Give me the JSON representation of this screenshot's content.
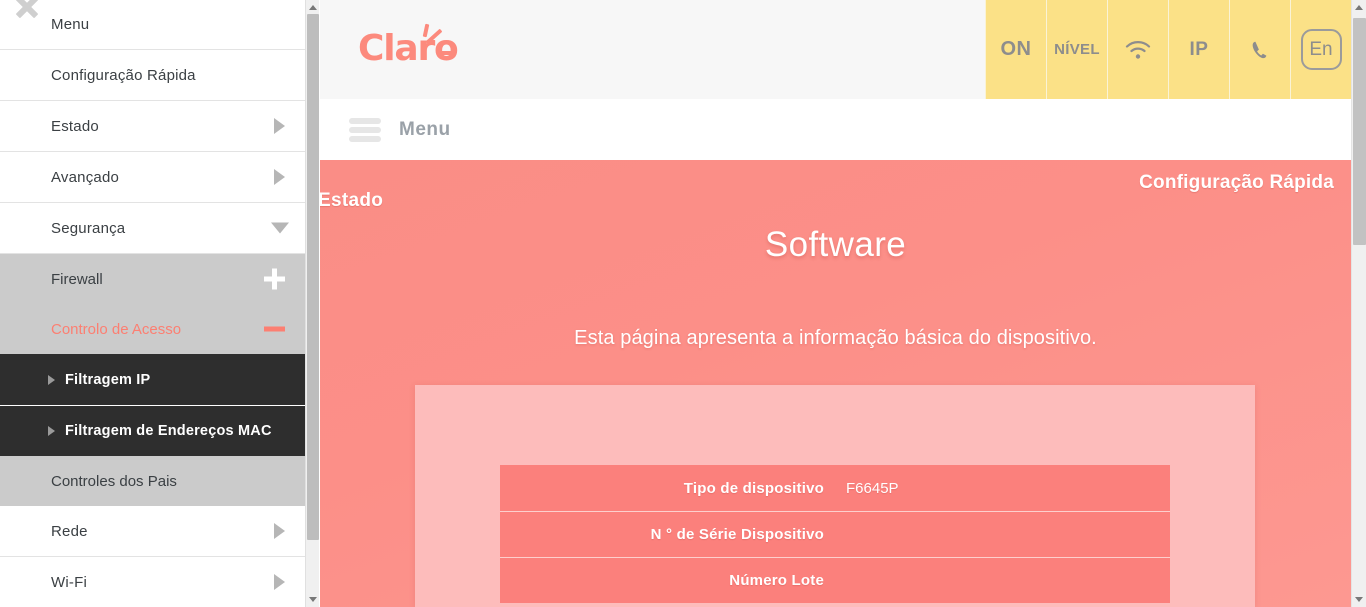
{
  "sidebar": {
    "close_icon": "close-x-icon",
    "top_label": "Menu",
    "items": [
      {
        "label": "Configuração Rápida",
        "arrow": "none"
      },
      {
        "label": "Estado",
        "arrow": "right"
      },
      {
        "label": "Avançado",
        "arrow": "right"
      },
      {
        "label": "Segurança",
        "arrow": "down"
      }
    ],
    "group": {
      "rows": [
        {
          "label": "Firewall",
          "toggle": "plus"
        },
        {
          "label": "Controlo de Acesso",
          "toggle": "minus",
          "active": true
        }
      ],
      "sub_items": [
        {
          "label": "Filtragem IP"
        },
        {
          "label": "Filtragem de Endereços MAC"
        }
      ],
      "tail_row": {
        "label": "Controles dos Pais"
      }
    },
    "items_after": [
      {
        "label": "Rede",
        "arrow": "right"
      },
      {
        "label": "Wi-Fi",
        "arrow": "right"
      }
    ]
  },
  "header": {
    "logo_text": "Claro",
    "status": {
      "on": "ON",
      "nivel": "NÍVEL",
      "wifi_icon": "wifi-icon",
      "ip": "IP",
      "phone_icon": "phone-icon",
      "lang": "En"
    }
  },
  "menubar": {
    "burger_icon": "hamburger-menu-icon",
    "label": "Menu"
  },
  "content": {
    "breadcrumb_left": "Estado",
    "breadcrumb_right": "Configuração Rápida",
    "title": "Software",
    "description": "Esta página apresenta a informação básica do dispositivo.",
    "table": {
      "rows": [
        {
          "key": "Tipo de dispositivo",
          "value": "F6645P"
        },
        {
          "key": "N ° de Série Dispositivo",
          "value": ""
        },
        {
          "key": "Número Lote",
          "value": ""
        }
      ]
    }
  },
  "colors": {
    "brand_salmon": "#fc8a7d",
    "content_pink": "#fb8b84",
    "panel_pink": "#fdbcbb",
    "row_pink": "#fb807c",
    "status_yellow": "#fbe187",
    "sidebar_gray": "#cbcbcb",
    "sidebar_dark": "#2e2e2e"
  }
}
